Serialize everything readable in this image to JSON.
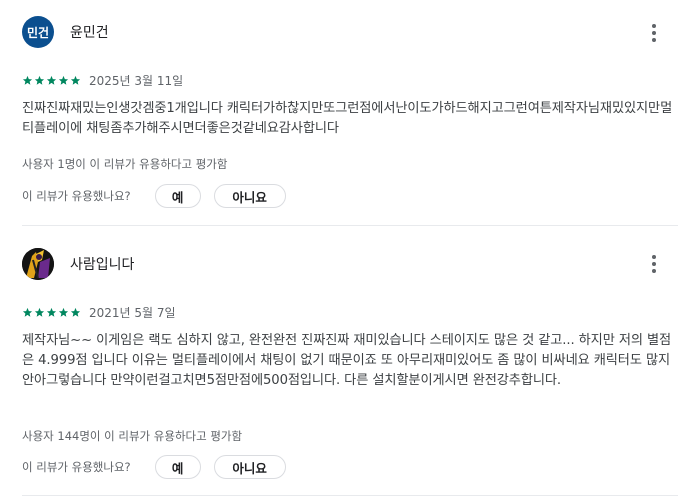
{
  "reviews": [
    {
      "author": "윤민건",
      "avatar_text": "민건",
      "avatar_color": "#0b4f8f",
      "rating": 5,
      "date": "2025년 3월 11일",
      "body": "진짜진짜재밌는인생갓겜중1개입니다 캐릭터가하찮지만또그런점에서난이도가하드해지고그런여튼제작자님재밌있지만멀티플레이에 채팅좀추가해주시면더좋은것같네요감사합니다",
      "helpful_count": "사용자 1명이 이 리뷰가 유용하다고 평가함",
      "helpful_question": "이 리뷰가 유용했나요?",
      "yes_label": "예",
      "no_label": "아니요"
    },
    {
      "author": "사람입니다",
      "avatar_text": "",
      "avatar_color": "#1a1a1a",
      "rating": 5,
      "date": "2021년 5월 7일",
      "body": "제작자님~~ 이게임은 랙도 심하지 않고, 완전완전 진짜진짜 재미있습니다 스테이지도 많은 것 같고... 하지만 저의 별점은 4.999점 입니다 이유는 멀티플레이에서 채팅이 없기 때문이죠 또 아무리재미있어도 좀 많이 비싸네요 캐릭터도 많지안아그렇습니다 만약이런걸고치면5점만점에500점입니다. 다른 설치할분이게시면 완전강추합니다.",
      "helpful_count": "사용자 144명이 이 리뷰가 유용하다고 평가함",
      "helpful_question": "이 리뷰가 유용했나요?",
      "yes_label": "예",
      "no_label": "아니요"
    }
  ],
  "colors": {
    "star": "#01875f",
    "divider": "#e8eaed",
    "secondary_text": "#5f6368"
  },
  "icons": {
    "more": "more-vert-icon",
    "star": "star-icon"
  }
}
